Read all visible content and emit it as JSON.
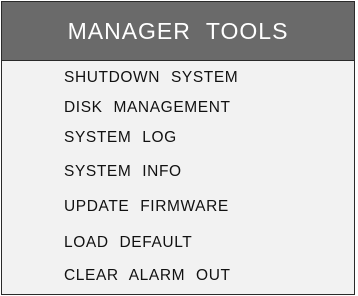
{
  "header": {
    "title": "MANAGER  TOOLS"
  },
  "menu": {
    "items": [
      {
        "label": "SHUTDOWN  SYSTEM"
      },
      {
        "label": "DISK  MANAGEMENT"
      },
      {
        "label": "SYSTEM  LOG"
      },
      {
        "label": "SYSTEM  INFO"
      },
      {
        "label": "UPDATE  FIRMWARE"
      },
      {
        "label": "LOAD   DEFAULT"
      },
      {
        "label": "CLEAR  ALARM  OUT"
      }
    ]
  },
  "colors": {
    "header_bg": "#6a6a6a",
    "panel_bg": "#f2f2f2",
    "text": "#111111",
    "header_text": "#ffffff"
  }
}
